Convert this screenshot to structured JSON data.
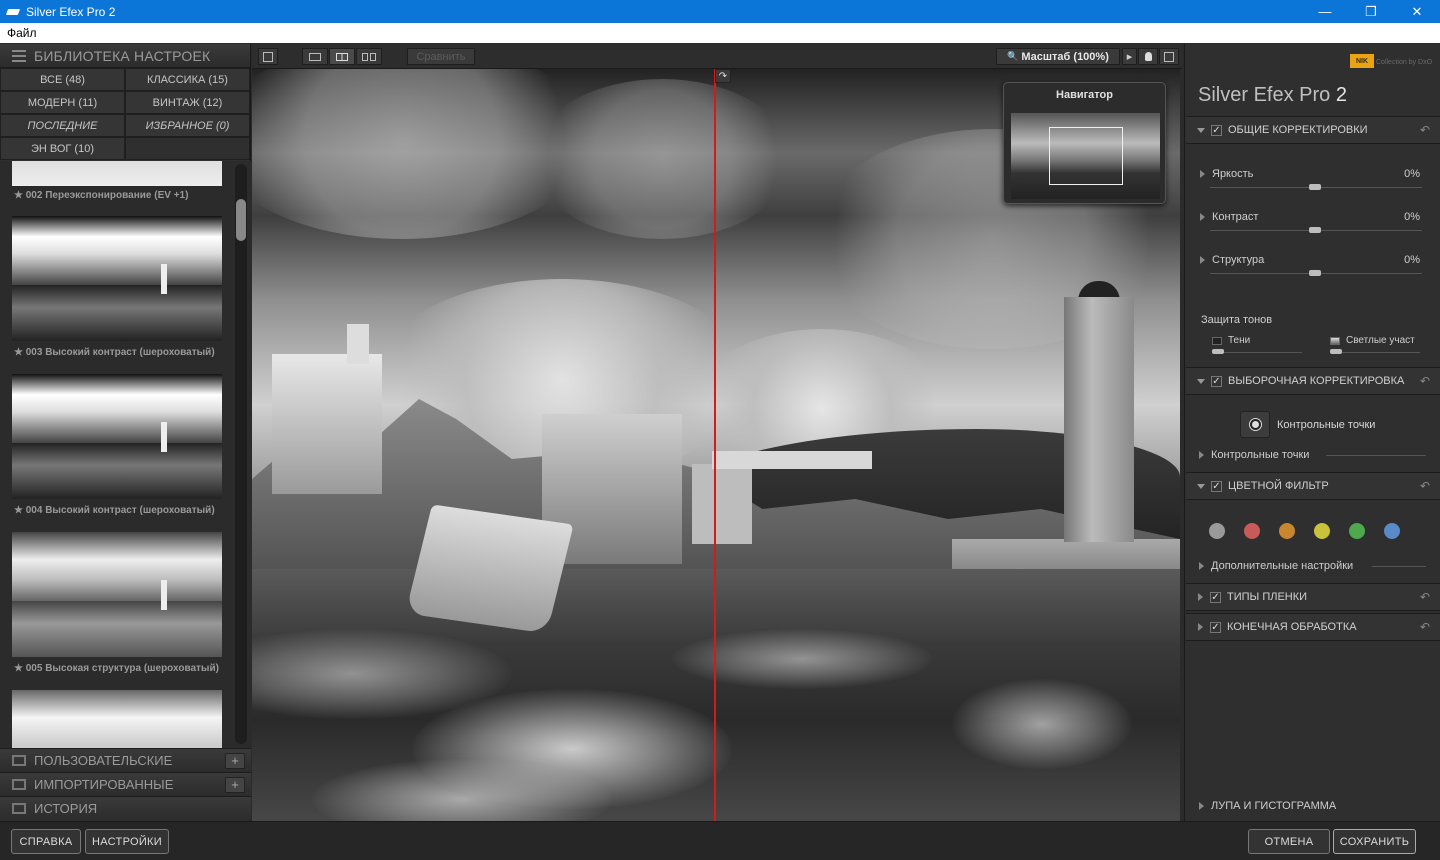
{
  "window": {
    "title": "Silver Efex Pro 2",
    "minimize": "—",
    "maximize": "❐",
    "close": "✕"
  },
  "menu": {
    "items": [
      "Файл"
    ]
  },
  "library": {
    "header": "БИБЛИОТЕКА НАСТРОЕК",
    "categories": [
      {
        "label": "ВСЕ (48)"
      },
      {
        "label": "КЛАССИКА (15)"
      },
      {
        "label": "МОДЕРН (11)"
      },
      {
        "label": "ВИНТАЖ (12)"
      },
      {
        "label": "ПОСЛЕДНИЕ"
      },
      {
        "label": "ИЗБРАННОЕ (0)"
      },
      {
        "label": "ЭН ВОГ (10)"
      }
    ],
    "presets": [
      {
        "label": "★ 002 Переэкспонирование  (EV +1)"
      },
      {
        "label": "★ 003 Высокий контраст (шероховатый)"
      },
      {
        "label": "★ 004 Высокий контраст (шероховатый)"
      },
      {
        "label": "★ 005 Высокая структура (шероховатый)"
      }
    ],
    "sections": [
      {
        "label": "ПОЛЬЗОВАТЕЛЬСКИЕ",
        "plus": "+"
      },
      {
        "label": "ИМПОРТИРОВАННЫЕ",
        "plus": "+"
      },
      {
        "label": "ИСТОРИЯ"
      }
    ]
  },
  "toolbar": {
    "compare": "Сравнить",
    "zoom": "Масштаб (100%)",
    "zoom_icon": "🔍",
    "zoom_arrow": "▸",
    "split_handle": "↷"
  },
  "navigator": {
    "title": "Навигатор"
  },
  "panel": {
    "brand": "NIK",
    "brand_sub": "Collection by DxO",
    "product_name": "Silver Efex Pro",
    "product_num": "2",
    "reset_icon": "↶",
    "global": {
      "title": "ОБЩИЕ КОРРЕКТИРОВКИ",
      "sliders": [
        {
          "label": "Яркость",
          "value": "0%",
          "level": 0.5
        },
        {
          "label": "Контраст",
          "value": "0%",
          "level": 0.5
        },
        {
          "label": "Структура",
          "value": "0%",
          "level": 0.5
        }
      ],
      "tone_protection": {
        "label": "Защита тонов",
        "shadows": "Тени",
        "highlights": "Светлые участ"
      }
    },
    "selective": {
      "title": "ВЫБОРОЧНАЯ КОРРЕКТИРОВКА",
      "button_label": "Контрольные точки",
      "sub": "Контрольные точки"
    },
    "color_filter": {
      "title": "ЦВЕТНОЙ ФИЛЬТР",
      "colors": [
        "#9a9a9a",
        "#c85a5a",
        "#c8862e",
        "#c9c23a",
        "#4ea84e",
        "#5a8ac8"
      ],
      "sub": "Дополнительные настройки"
    },
    "film": {
      "title": "ТИПЫ ПЛЕНКИ"
    },
    "finishing": {
      "title": "КОНЕЧНАЯ ОБРАБОТКА"
    },
    "loupe": "ЛУПА И ГИСТОГРАММА"
  },
  "footer": {
    "help": "СПРАВКА",
    "settings": "НАСТРОЙКИ",
    "cancel": "ОТМЕНА",
    "save": "СОХРАНИТЬ"
  },
  "check": "✓"
}
